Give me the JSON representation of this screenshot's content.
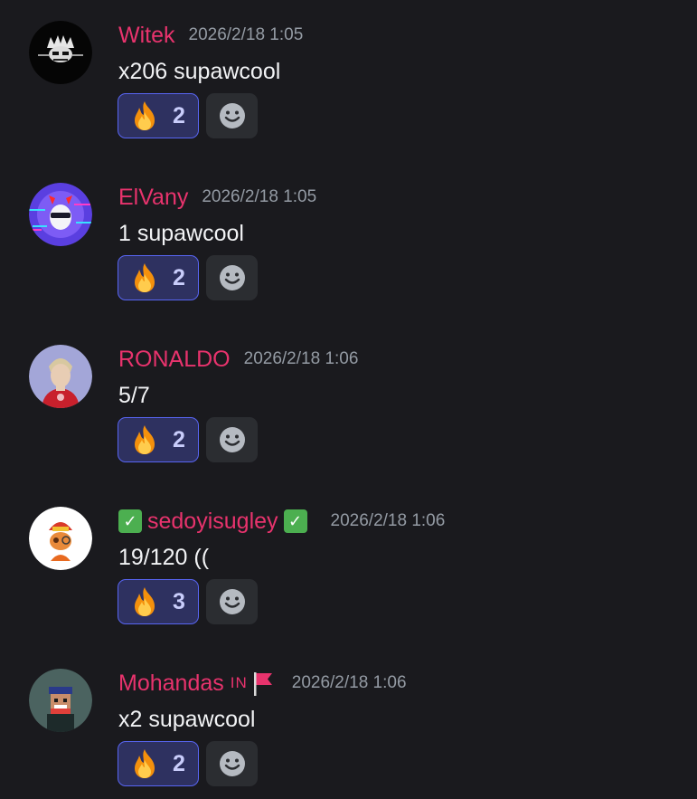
{
  "messages": [
    {
      "username": "Witek",
      "timestamp": "2026/2/18 1:05",
      "content": "x206 supawcool",
      "reaction": {
        "emoji": "fire",
        "count": "2"
      }
    },
    {
      "username": "ElVany",
      "timestamp": "2026/2/18 1:05",
      "content": "1 supawcool",
      "reaction": {
        "emoji": "fire",
        "count": "2"
      }
    },
    {
      "username": "RONALDO",
      "timestamp": "2026/2/18 1:06",
      "content": "5/7",
      "reaction": {
        "emoji": "fire",
        "count": "2"
      }
    },
    {
      "username": "sedoyisugley",
      "timestamp": "2026/2/18 1:06",
      "content": "19/120 ((",
      "reaction": {
        "emoji": "fire",
        "count": "3"
      }
    },
    {
      "username": "Mohandas",
      "tag": "IN",
      "timestamp": "2026/2/18 1:06",
      "content": "x2 supawcool",
      "reaction": {
        "emoji": "fire",
        "count": "2"
      }
    }
  ],
  "colors": {
    "background": "#1a1a1e",
    "username": "#e8336d",
    "timestamp": "#949ba4",
    "text": "#f2f3f5",
    "reaction_bg": "#2e3160",
    "reaction_border": "#5865f2",
    "add_reaction_bg": "#2b2d31"
  },
  "icons": {
    "reaction": "fire-icon",
    "add_reaction": "smiley-icon",
    "badge": "check-mark-icon",
    "flag": "red-flag-icon"
  }
}
